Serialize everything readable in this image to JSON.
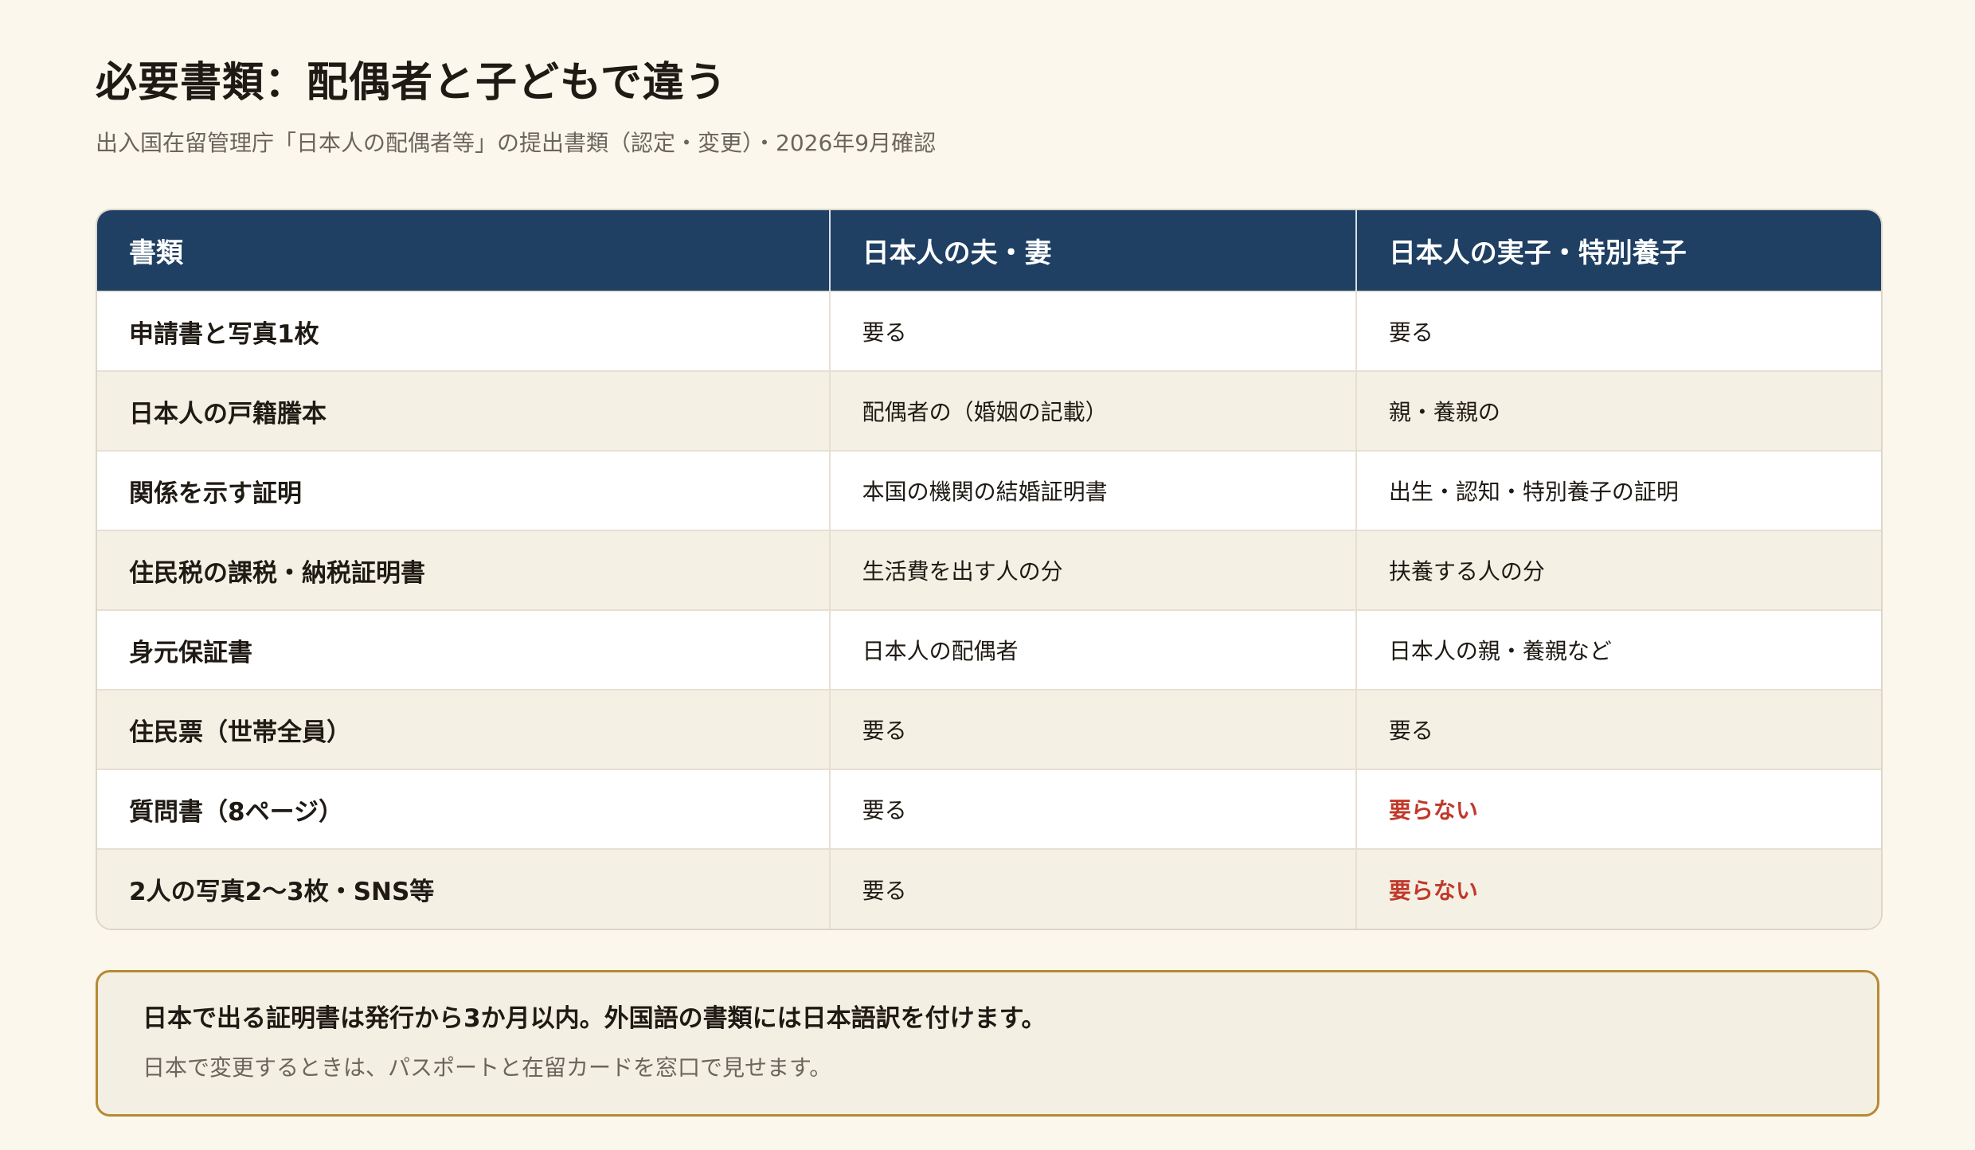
{
  "header": {
    "title": "必要書類：配偶者と子どもで違う",
    "subtitle": "出入国在留管理庁「日本人の配偶者等」の提出書類（認定・変更）・2026年9月確認"
  },
  "table": {
    "columns": [
      "書類",
      "日本人の夫・妻",
      "日本人の実子・特別養子"
    ],
    "rows": [
      {
        "document": "申請書と写真1枚",
        "spouse": "要る",
        "child": "要る",
        "child_status": "normal"
      },
      {
        "document": "日本人の戸籍謄本",
        "spouse": "配偶者の（婚姻の記載）",
        "child": "親・養親の",
        "child_status": "normal"
      },
      {
        "document": "関係を示す証明",
        "spouse": "本国の機関の結婚証明書",
        "child": "出生・認知・特別養子の証明",
        "child_status": "normal"
      },
      {
        "document": "住民税の課税・納税証明書",
        "spouse": "生活費を出す人の分",
        "child": "扶養する人の分",
        "child_status": "normal"
      },
      {
        "document": "身元保証書",
        "spouse": "日本人の配偶者",
        "child": "日本人の親・養親など",
        "child_status": "normal"
      },
      {
        "document": "住民票（世帯全員）",
        "spouse": "要る",
        "child": "要る",
        "child_status": "normal"
      },
      {
        "document": "質問書（8ページ）",
        "spouse": "要る",
        "child": "要らない",
        "child_status": "not-required"
      },
      {
        "document": "2人の写真2〜3枚・SNS等",
        "spouse": "要る",
        "child": "要らない",
        "child_status": "not-required"
      }
    ]
  },
  "note": {
    "main": "日本で出る証明書は発行から3か月以内。外国語の書類には日本語訳を付けます。",
    "sub": "日本で変更するときは、パスポートと在留カードを窓口で見せます。"
  },
  "colors": {
    "background": "#fbf7ec",
    "header_bg": "#1f3f63",
    "not_required": "#c0392b",
    "note_border": "#b58a33"
  }
}
